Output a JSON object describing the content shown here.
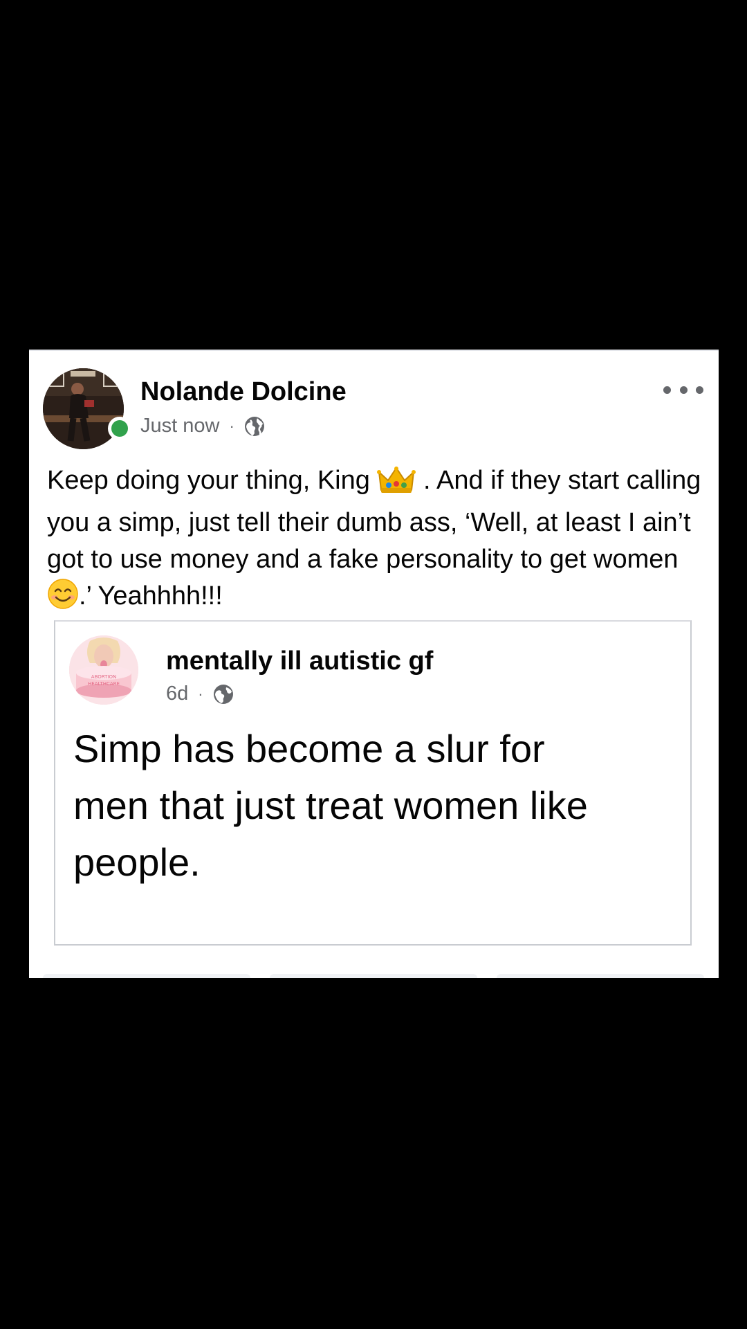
{
  "post": {
    "author_name": "Nolande Dolcine",
    "timestamp": "Just now",
    "separator": "·",
    "audience_icon": "globe-icon",
    "more_icon": "more-options-icon",
    "text_part1": "Keep doing your thing, King",
    "emoji1": "crown-emoji",
    "text_part2": ". And if they start calling you a simp, just tell their dumb ass, ‘Well, at least I ain’t got to use money and a fake personality to get women",
    "emoji2": "smiling-face-emoji",
    "text_part3": ".’ Yeahhhh!!!"
  },
  "shared_post": {
    "author_name": "mentally ill autistic gf",
    "timestamp": "6d",
    "separator": "·",
    "audience_icon": "globe-icon",
    "text": "Simp has become a slur for men that just treat women like people."
  },
  "colors": {
    "background": "#000000",
    "card": "#ffffff",
    "primary_text": "#050505",
    "secondary_text": "#65676b",
    "online": "#31a24c",
    "border": "#c9ccd1"
  }
}
